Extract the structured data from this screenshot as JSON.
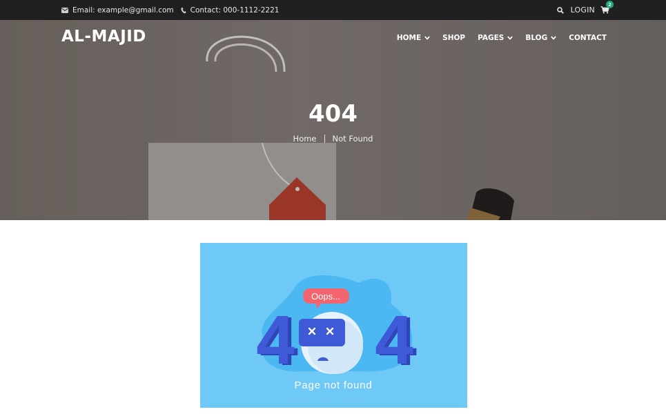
{
  "topbar": {
    "email_text": "Email: example@gmail.com",
    "contact_text": "Contact: 000-1112-2221",
    "login_label": "LOGIN",
    "cart_count": "2"
  },
  "header": {
    "logo": "AL-MAJID",
    "nav": [
      "HOME",
      "SHOP",
      "PAGES",
      "BLOG",
      "CONTACT"
    ]
  },
  "hero": {
    "title": "404",
    "breadcrumb": [
      "Home",
      "Not Found"
    ]
  },
  "illustration": {
    "bubble_text": "Oops...",
    "left_digit": "4",
    "right_digit": "4",
    "caption": "Page not found"
  },
  "colors": {
    "topbar_bg": "#202020",
    "illustration_bg": "#6ec9f7",
    "digit_color": "#3f5ad6",
    "bubble_color": "#f2656f",
    "badge_color": "#1fa87a"
  },
  "icons": [
    "envelope-icon",
    "phone-icon",
    "search-icon",
    "cart-icon",
    "chevron-down-icon"
  ]
}
